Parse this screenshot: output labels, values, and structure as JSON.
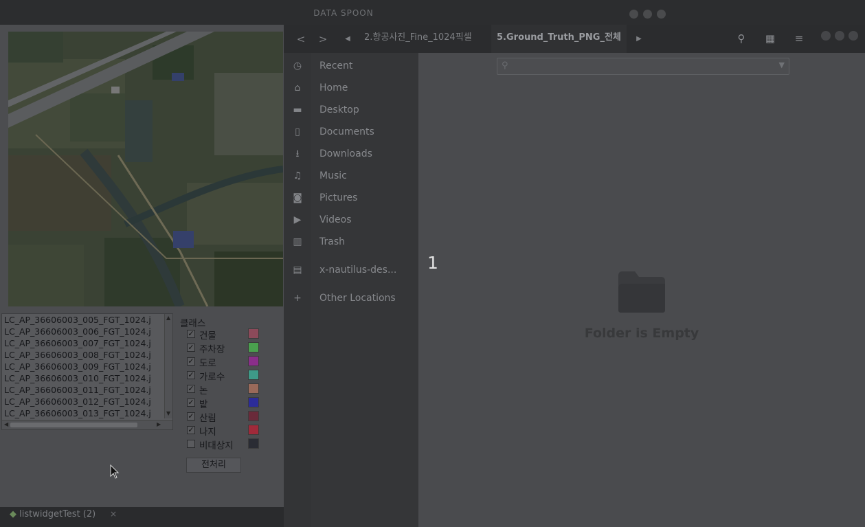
{
  "window": {
    "title": "DATA SPOON"
  },
  "app": {
    "file_list": [
      "LC_AP_36606003_005_FGT_1024.j",
      "LC_AP_36606003_006_FGT_1024.j",
      "LC_AP_36606003_007_FGT_1024.j",
      "LC_AP_36606003_008_FGT_1024.j",
      "LC_AP_36606003_009_FGT_1024.j",
      "LC_AP_36606003_010_FGT_1024.j",
      "LC_AP_36606003_011_FGT_1024.j",
      "LC_AP_36606003_012_FGT_1024.j",
      "LC_AP_36606003_013_FGT_1024.j"
    ],
    "classes_header": "클래스",
    "classes": [
      {
        "label": "건물",
        "checked": true,
        "color": "#8c4a5a"
      },
      {
        "label": "주차장",
        "checked": true,
        "color": "#4aa04e"
      },
      {
        "label": "도로",
        "checked": true,
        "color": "#8a2e8a"
      },
      {
        "label": "가로수",
        "checked": true,
        "color": "#3e9a88"
      },
      {
        "label": "논",
        "checked": true,
        "color": "#9a6a5a"
      },
      {
        "label": "밭",
        "checked": true,
        "color": "#2c2c9a"
      },
      {
        "label": "산림",
        "checked": true,
        "color": "#6a2a3a"
      },
      {
        "label": "나지",
        "checked": true,
        "color": "#a02a3a"
      },
      {
        "label": "비대상지",
        "checked": false,
        "color": "#2a2c34"
      }
    ],
    "preprocess_button": "전처리"
  },
  "taskbar": {
    "tab_label": "listwidgetTest (2)",
    "close": "×"
  },
  "file_manager": {
    "breadcrumbs": [
      "2.항공사진_Fine_1024픽셀",
      "5.Ground_Truth_PNG_전체"
    ],
    "sidebar": [
      {
        "icon": "clock-icon",
        "glyph": "◷",
        "label": "Recent"
      },
      {
        "icon": "home-icon",
        "glyph": "⌂",
        "label": "Home"
      },
      {
        "icon": "folder-icon",
        "glyph": "▬",
        "label": "Desktop"
      },
      {
        "icon": "document-icon",
        "glyph": "▯",
        "label": "Documents"
      },
      {
        "icon": "download-icon",
        "glyph": "⭳",
        "label": "Downloads"
      },
      {
        "icon": "music-icon",
        "glyph": "♫",
        "label": "Music"
      },
      {
        "icon": "camera-icon",
        "glyph": "◙",
        "label": "Pictures"
      },
      {
        "icon": "video-icon",
        "glyph": "▶",
        "label": "Videos"
      },
      {
        "icon": "trash-icon",
        "glyph": "▥",
        "label": "Trash"
      },
      {
        "icon": "network-drive-icon",
        "glyph": "▤",
        "label": "x-nautilus-des..."
      },
      {
        "icon": "plus-icon",
        "glyph": "+",
        "label": "Other Locations"
      }
    ],
    "empty_text": "Folder is Empty"
  },
  "overlay_number": "1"
}
